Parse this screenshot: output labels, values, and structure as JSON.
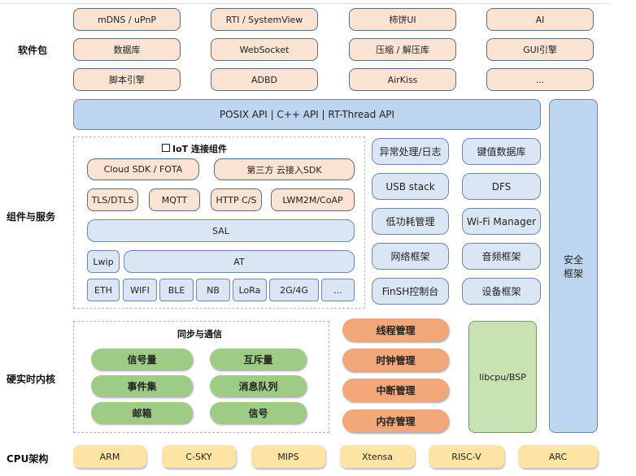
{
  "layers": {
    "software": "软件包",
    "components": "组件与服务",
    "kernel": "硬实时内核",
    "cpu": "CPU架构"
  },
  "packages": [
    "mDNS / uPnP",
    "RTI / SystemView",
    "柿饼UI",
    "AI",
    "数据库",
    "WebSocket",
    "压缩 / 解压库",
    "GUI引擎",
    "脚本引擎",
    "ADBD",
    "AirKiss",
    "..."
  ],
  "api": "POSIX API  |  C++ API  |  RT-Thread API",
  "security": "安全\n框架",
  "iot": {
    "title": "IoT 连接组件",
    "row1": [
      "Cloud SDK / FOTA",
      "第三方 云接入SDK"
    ],
    "row2": [
      "TLS/DTLS",
      "MQTT",
      "HTTP C/S",
      "LWM2M/CoAP"
    ],
    "sal": "SAL",
    "lwip": "Lwip",
    "at": "AT",
    "row5": [
      "ETH",
      "WIFI",
      "BLE",
      "NB",
      "LoRa",
      "2G/4G",
      "..."
    ]
  },
  "services": [
    "异常处理/日志",
    "键值数据库",
    "USB stack",
    "DFS",
    "低功耗管理",
    "Wi-Fi Manager",
    "网络框架",
    "音频框架",
    "FinSH控制台",
    "设备框架"
  ],
  "sync": {
    "title": "同步与通信",
    "items": [
      "信号量",
      "互斥量",
      "事件集",
      "消息队列",
      "邮箱",
      "信号"
    ]
  },
  "kernel_mgmt": [
    "线程管理",
    "时钟管理",
    "中断管理",
    "内存管理"
  ],
  "libcpu": "libcpu/BSP",
  "cpus": [
    "ARM",
    "C-SKY",
    "MIPS",
    "Xtensa",
    "RISC-V",
    "ARC"
  ],
  "colors": {
    "package": "#fbe3d3",
    "component": "#dbe6f4",
    "api": "#bdd5ee",
    "sync": "#9fcc84",
    "kernel": "#f2a77a",
    "cpu": "#fde4a4",
    "libcpu": "#c8e2b4"
  }
}
